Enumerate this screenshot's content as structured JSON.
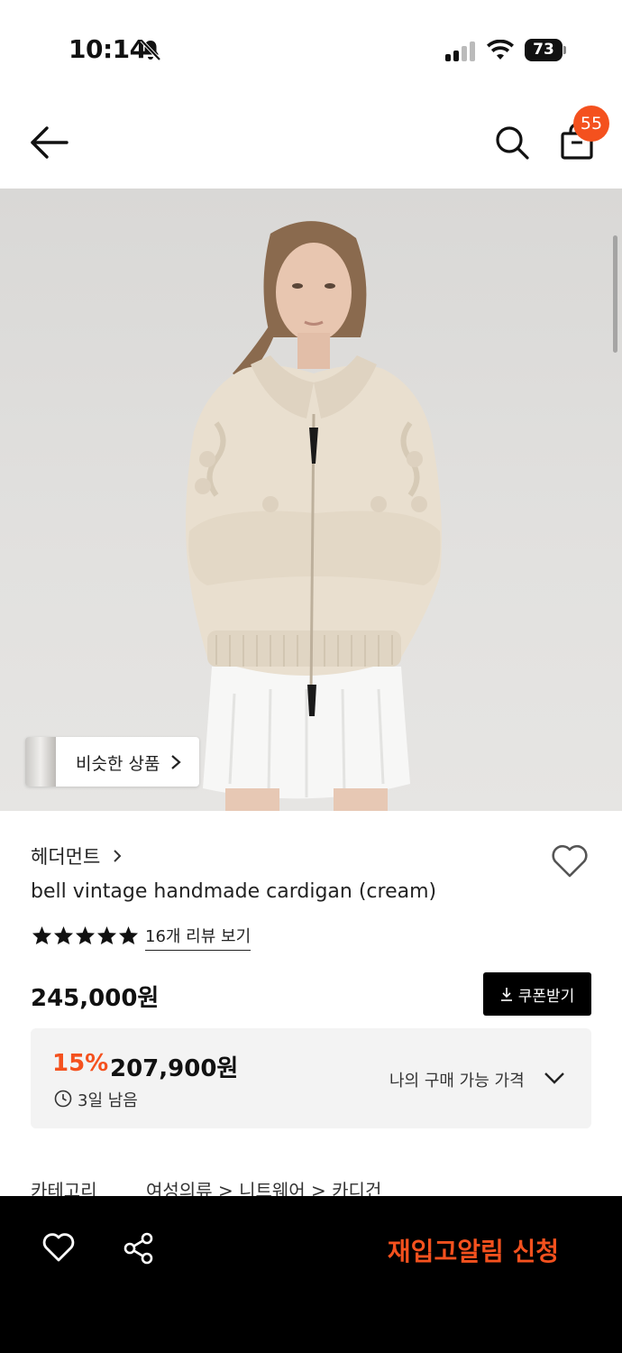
{
  "status_bar": {
    "time": "10:14",
    "battery": "73",
    "icons": [
      "bell-slash-icon",
      "cellular-signal-icon",
      "wifi-icon",
      "battery-icon"
    ]
  },
  "nav": {
    "icons": [
      "back-arrow-icon",
      "search-icon",
      "shopping-bag-icon"
    ],
    "cart_count": "55"
  },
  "hero": {
    "similar_label": "비슷한 상품"
  },
  "product": {
    "brand": "헤더먼트",
    "title": "bell vintage handmade cardigan (cream)",
    "rating_stars": 5,
    "review_link": "16개 리뷰 보기",
    "price": "245,000원",
    "coupon_label": "쿠폰받기"
  },
  "discount": {
    "percent": "15%",
    "price": "207,900원",
    "remaining": "3일 남음",
    "my_price_label": "나의 구매 가능 가격"
  },
  "category": {
    "label": "카테고리",
    "path": "여성의류 > 니트웨어 > 카디건"
  },
  "bottom_bar": {
    "cta": "재입고알림 신청",
    "icons": [
      "heart-icon",
      "share-icon"
    ]
  },
  "colors": {
    "accent": "#f4511e",
    "dark": "#000000",
    "panel": "#f3f3f3"
  }
}
